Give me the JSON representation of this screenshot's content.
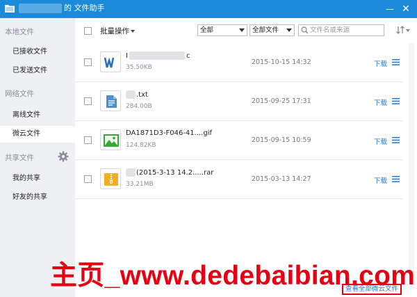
{
  "window": {
    "title": "的 文件助手",
    "minimize_glyph": "—",
    "close_glyph": "✕"
  },
  "sidebar": {
    "sections": [
      {
        "label": "本地文件",
        "items": [
          "已接收文件",
          "已发送文件"
        ]
      },
      {
        "label": "网络文件",
        "items": [
          "离线文件",
          "微云文件"
        ]
      },
      {
        "label": "共享文件",
        "items": [
          "我的共享",
          "好友的共享"
        ]
      }
    ],
    "active_item": "微云文件"
  },
  "toolbar": {
    "batch_label": "批量操作",
    "filter_select": "全部",
    "type_select": "全部文件",
    "search_placeholder": "文件名或来源"
  },
  "files": [
    {
      "name_prefix": "I",
      "name_suffix": "c",
      "size": "35.50KB",
      "date": "2015-10-15 14:32",
      "download": "下载",
      "type": "word"
    },
    {
      "name_prefix": "",
      "name_suffix": ".txt",
      "size": "284.00B",
      "date": "2015-09-25 17:31",
      "download": "下载",
      "type": "text"
    },
    {
      "name_prefix": "DA1871D3-F046-41....gif",
      "name_suffix": "",
      "size": "124.82KB",
      "date": "2015-09-15 10:59",
      "download": "下载",
      "type": "image"
    },
    {
      "name_prefix": "",
      "name_suffix": "(2015-3-13 14.2.....rar",
      "size": "33.21MB",
      "date": "2015-03-13 14:27",
      "download": "下载",
      "type": "archive"
    }
  ],
  "footer": {
    "view_all": "查看全部微云文件"
  },
  "watermark": "主页_www.dedebaibian.com",
  "colors": {
    "titlebar": "#1b8ad8",
    "link": "#1f77d0",
    "watermark": "#e60012",
    "word_icon": "#2b6fc2",
    "text_icon": "#4a8fd0",
    "image_icon": "#3aa63a",
    "archive_icon": "#f2b01e"
  }
}
